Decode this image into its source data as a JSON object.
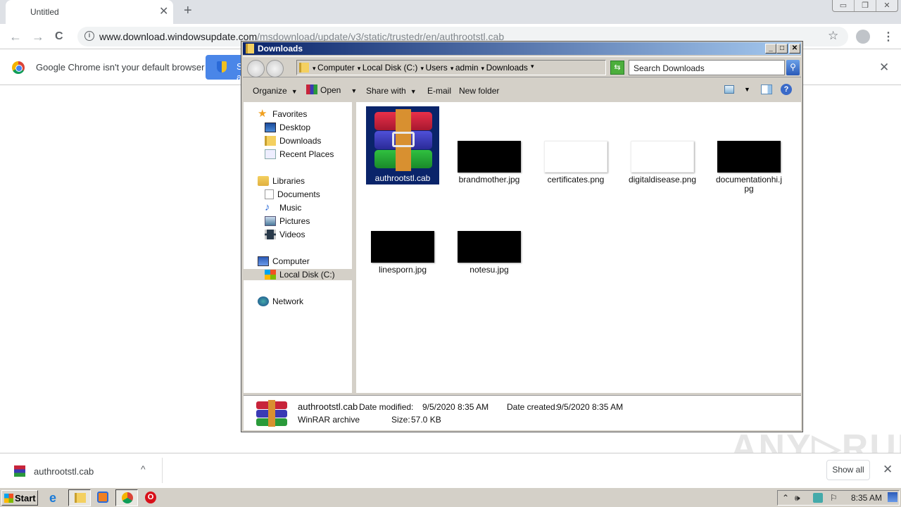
{
  "browser": {
    "tab_title": "Untitled",
    "url_host": "www.download.windowsupdate.com",
    "url_path": "/msdownload/update/v3/static/trustedr/en/authrootstl.cab",
    "infobar_text": "Google Chrome isn't your default browser",
    "infobar_button": "Set as default",
    "icons": {
      "tab_close": "✕",
      "new_tab": "+",
      "back": "←",
      "forward": "→",
      "reload": "C",
      "star": "☆",
      "menu": "⋮",
      "close": "✕"
    }
  },
  "window_controls": {
    "minimize": "▭",
    "restore": "❐",
    "close": "✕"
  },
  "explorer": {
    "title": "Downloads",
    "caption": {
      "minimize": "_",
      "maximize": "□",
      "close": "✕"
    },
    "breadcrumbs": [
      "Computer",
      "Local Disk (C:)",
      "Users",
      "admin",
      "Downloads"
    ],
    "search_placeholder": "Search Downloads",
    "commands": {
      "organize": "Organize",
      "open": "Open",
      "share": "Share with",
      "email": "E-mail",
      "new_folder": "New folder"
    },
    "nav": {
      "favorites": "Favorites",
      "desktop": "Desktop",
      "downloads": "Downloads",
      "recent": "Recent Places",
      "libraries": "Libraries",
      "documents": "Documents",
      "music": "Music",
      "pictures": "Pictures",
      "videos": "Videos",
      "computer": "Computer",
      "local_disk": "Local Disk (C:)",
      "network": "Network"
    },
    "files": [
      {
        "name": "authrootstl.cab",
        "thumb": "winrar",
        "selected": true
      },
      {
        "name": "brandmother.jpg",
        "thumb": "black"
      },
      {
        "name": "certificates.png",
        "thumb": "white"
      },
      {
        "name": "digitaldisease.png",
        "thumb": "white"
      },
      {
        "name": "documentationhi.jpg",
        "thumb": "black"
      },
      {
        "name": "linesporn.jpg",
        "thumb": "black"
      },
      {
        "name": "notesu.jpg",
        "thumb": "black"
      }
    ],
    "details": {
      "name": "authrootstl.cab",
      "type": "WinRAR archive",
      "modified_label": "Date modified:",
      "modified": "9/5/2020 8:35 AM",
      "created_label": "Date created:",
      "created": "9/5/2020 8:35 AM",
      "size_label": "Size:",
      "size": "57.0 KB"
    }
  },
  "downloads_bar": {
    "file": "authrootstl.cab",
    "show_all": "Show all",
    "chevron": "^"
  },
  "watermark": "ANY▷RUN",
  "taskbar": {
    "start": "Start",
    "clock": "8:35 AM"
  }
}
